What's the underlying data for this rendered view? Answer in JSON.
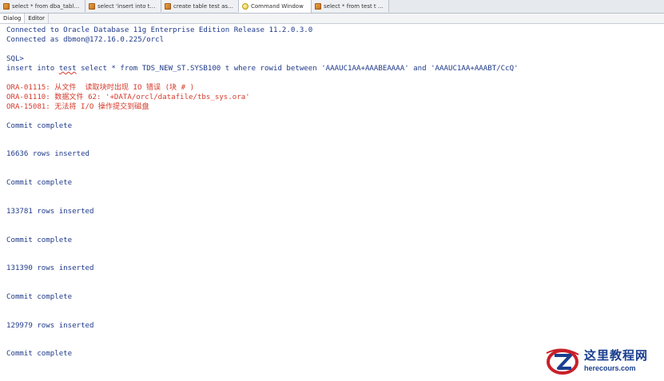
{
  "tabs": [
    {
      "label": "select * from dba_tables w ...",
      "icon": "sql-window-icon"
    },
    {
      "label": "select 'insert into test s ...",
      "icon": "sql-window-icon"
    },
    {
      "label": "create table test as selec ...",
      "icon": "sql-window-icon"
    },
    {
      "label": "Command Window",
      "icon": "command-window-icon",
      "active": true
    },
    {
      "label": "select * from test t selec ...",
      "icon": "sql-window-icon"
    }
  ],
  "subtabs": {
    "dialog": "Dialog",
    "editor": "Editor"
  },
  "console": {
    "connected_db": "Connected to Oracle Database 11g Enterprise Edition Release 11.2.0.3.0",
    "connected_as": "Connected as dbmon@172.16.0.225/orcl",
    "prompt": "SQL>",
    "cmd_before": "insert into ",
    "cmd_word": "test",
    "cmd_after": " select * from TDS_NEW_ST.SYSB100 t where rowid between 'AAAUC1AA+AAABEAAAA' and 'AAAUC1AA+AAABT/CcQ'",
    "err1": "ORA-01115: 从文件  读取块时出现 IO 错误 (块 # )",
    "err2": "ORA-01110: 数据文件 62: '+DATA/orcl/datafile/tbs_sys.ora'",
    "err3": "ORA-15081: 无法将 I/O 操作提交到磁盘",
    "commit1": "Commit complete",
    "rows1": "16636 rows inserted",
    "commit2": "Commit complete",
    "rows2": "133781 rows inserted",
    "commit3": "Commit complete",
    "rows3": "131390 rows inserted",
    "commit4": "Commit complete",
    "rows4": "129979 rows inserted",
    "commit5": "Commit complete"
  },
  "watermark": {
    "cn": "这里教程网",
    "url": "herecours.com"
  }
}
